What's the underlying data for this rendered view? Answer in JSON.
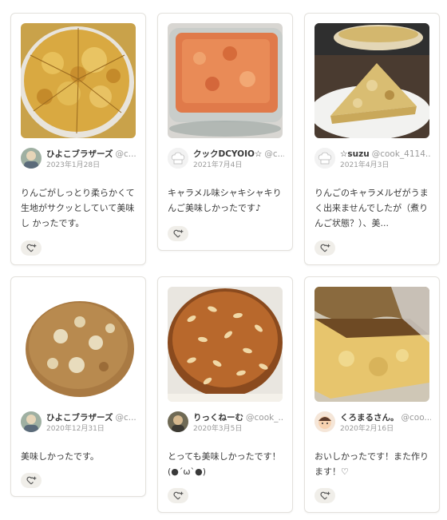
{
  "cards": [
    {
      "author_name": "ひよこブラザーズ",
      "author_handle": "@c...",
      "date": "2023年1月28日",
      "comment": "りんごがしっとり柔らかくて 生地がサクッとしていて美味し かったです。",
      "avatar_icon": "person-photo-avatar",
      "like_icon": "heart-plus-icon"
    },
    {
      "author_name": "クックDCYOIO☆",
      "author_handle": "@c...",
      "date": "2021年7月4日",
      "comment": "キャラメル味シャキシャキりんご美味しかったです♪",
      "avatar_icon": "chef-hat-avatar",
      "like_icon": "heart-plus-icon"
    },
    {
      "author_name": "☆suzu",
      "author_handle": "@cook_4114...",
      "date": "2021年4月3日",
      "comment": "りんごのキャラメルゼがうまく出来ませんでしたが（煮りんご状態？）、美...",
      "avatar_icon": "chef-hat-avatar",
      "like_icon": "heart-plus-icon"
    },
    {
      "author_name": "ひよこブラザーズ",
      "author_handle": "@c...",
      "date": "2020年12月31日",
      "comment": "美味しかったです。",
      "avatar_icon": "person-photo-avatar",
      "like_icon": "heart-plus-icon"
    },
    {
      "author_name": "りっくねーむ",
      "author_handle": "@cook_...",
      "date": "2020年3月5日",
      "comment": "とっても美味しかったです！(●´ω`●)",
      "avatar_icon": "person-photo-avatar",
      "like_icon": "heart-plus-icon"
    },
    {
      "author_name": "くろまるさん。",
      "author_handle": "@coo...",
      "date": "2020年2月16日",
      "comment": "おいしかったです！また作ります！♡",
      "avatar_icon": "cartoon-face-avatar",
      "like_icon": "heart-plus-icon"
    }
  ]
}
